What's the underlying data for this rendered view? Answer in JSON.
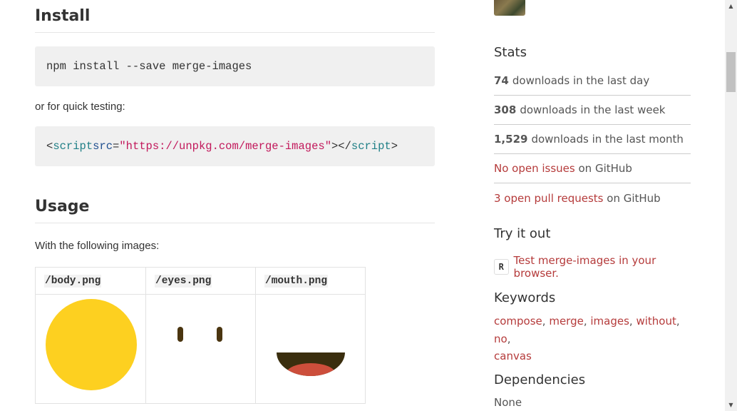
{
  "install": {
    "heading": "Install",
    "npm_command": "npm install --save merge-images",
    "quick_testing_text": "or for quick testing:",
    "script_tag": {
      "open_bracket": "<",
      "tag": "script",
      "attr": "src",
      "equals": "=",
      "value": "\"https://unpkg.com/merge-images\"",
      "close": "></",
      "end_tag": "script",
      "end_bracket": ">"
    }
  },
  "usage": {
    "heading": "Usage",
    "intro": "With the following images:",
    "images": [
      {
        "filename": "/body.png"
      },
      {
        "filename": "/eyes.png"
      },
      {
        "filename": "/mouth.png"
      }
    ]
  },
  "sidebar": {
    "stats_heading": "Stats",
    "stats": [
      {
        "count": "74",
        "label": "downloads in the last day"
      },
      {
        "count": "308",
        "label": "downloads in the last week"
      },
      {
        "count": "1,529",
        "label": "downloads in the last month"
      }
    ],
    "issues": {
      "link": "No open issues",
      "suffix": "on GitHub"
    },
    "pulls": {
      "link": "3 open pull requests",
      "suffix": "on GitHub"
    },
    "try_heading": "Try it out",
    "try_badge": "R",
    "try_link": "Test merge-images in your browser.",
    "keywords_heading": "Keywords",
    "keywords": [
      "compose",
      "merge",
      "images",
      "without",
      "no",
      "canvas"
    ],
    "dependencies_heading": "Dependencies",
    "dependencies_value": "None"
  },
  "colors": {
    "link": "#b53b3b",
    "body_yellow": "#fdd020",
    "eyes_brown": "#4a3510",
    "mouth_dark": "#3a2e0e",
    "tongue_red": "#cc4e3b"
  }
}
